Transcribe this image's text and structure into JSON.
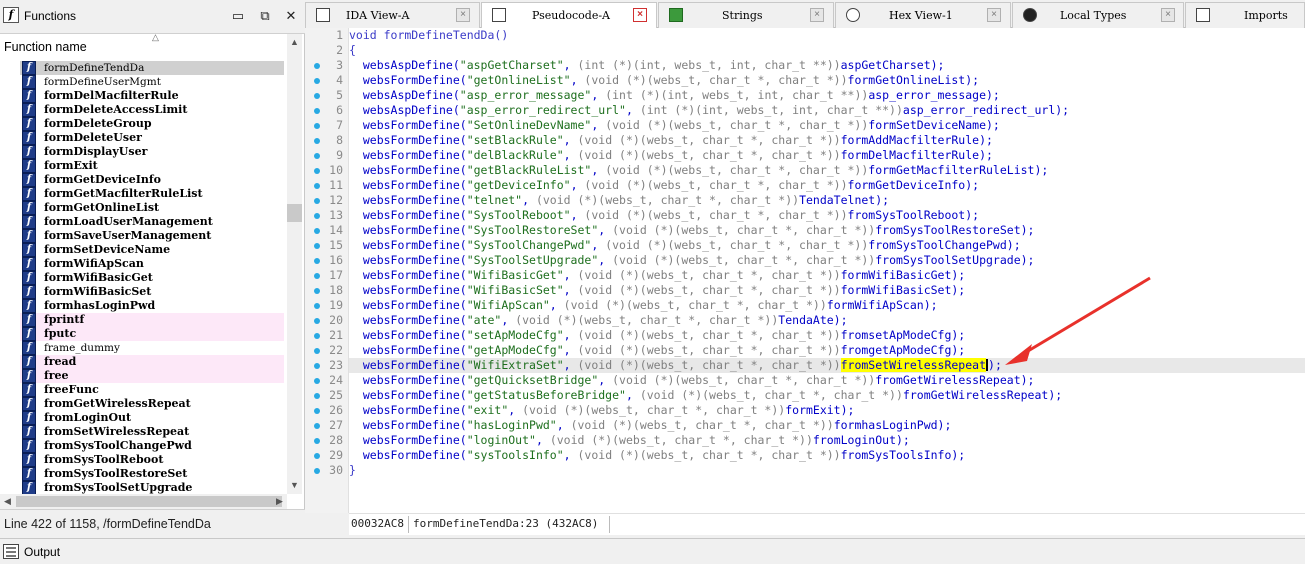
{
  "functions_panel": {
    "title": "Functions",
    "column_header": "Function name",
    "status": "Line 422 of 1158, /formDefineTendDa",
    "items": [
      {
        "name": "formDefineTendDa",
        "style": "normal",
        "highlight": "selected"
      },
      {
        "name": "formDefineUserMgmt",
        "style": "normal",
        "highlight": "none"
      },
      {
        "name": "formDelMacfilterRule",
        "style": "bold",
        "highlight": "none"
      },
      {
        "name": "formDeleteAccessLimit",
        "style": "bold",
        "highlight": "none"
      },
      {
        "name": "formDeleteGroup",
        "style": "bold",
        "highlight": "none"
      },
      {
        "name": "formDeleteUser",
        "style": "bold",
        "highlight": "none"
      },
      {
        "name": "formDisplayUser",
        "style": "bold",
        "highlight": "none"
      },
      {
        "name": "formExit",
        "style": "bold",
        "highlight": "none"
      },
      {
        "name": "formGetDeviceInfo",
        "style": "bold",
        "highlight": "none"
      },
      {
        "name": "formGetMacfilterRuleList",
        "style": "bold",
        "highlight": "none"
      },
      {
        "name": "formGetOnlineList",
        "style": "bold",
        "highlight": "none"
      },
      {
        "name": "formLoadUserManagement",
        "style": "bold",
        "highlight": "none"
      },
      {
        "name": "formSaveUserManagement",
        "style": "bold",
        "highlight": "none"
      },
      {
        "name": "formSetDeviceName",
        "style": "bold",
        "highlight": "none"
      },
      {
        "name": "formWifiApScan",
        "style": "bold",
        "highlight": "none"
      },
      {
        "name": "formWifiBasicGet",
        "style": "bold",
        "highlight": "none"
      },
      {
        "name": "formWifiBasicSet",
        "style": "bold",
        "highlight": "none"
      },
      {
        "name": "formhasLoginPwd",
        "style": "bold",
        "highlight": "none"
      },
      {
        "name": "fprintf",
        "style": "bold",
        "highlight": "pink"
      },
      {
        "name": "fputc",
        "style": "bold",
        "highlight": "pink"
      },
      {
        "name": "frame_dummy",
        "style": "normal",
        "highlight": "none"
      },
      {
        "name": "fread",
        "style": "bold",
        "highlight": "pink"
      },
      {
        "name": "free",
        "style": "bold",
        "highlight": "pink"
      },
      {
        "name": "freeFunc",
        "style": "bold",
        "highlight": "none"
      },
      {
        "name": "fromGetWirelessRepeat",
        "style": "bold",
        "highlight": "none"
      },
      {
        "name": "fromLoginOut",
        "style": "bold",
        "highlight": "none"
      },
      {
        "name": "fromSetWirelessRepeat",
        "style": "bold",
        "highlight": "none"
      },
      {
        "name": "fromSysToolChangePwd",
        "style": "bold",
        "highlight": "none"
      },
      {
        "name": "fromSysToolReboot",
        "style": "bold",
        "highlight": "none"
      },
      {
        "name": "fromSysToolRestoreSet",
        "style": "bold",
        "highlight": "none"
      },
      {
        "name": "fromSysToolSetUpgrade",
        "style": "bold",
        "highlight": "none"
      }
    ]
  },
  "tabs": [
    {
      "label": "IDA View-A",
      "icon": "ida-view-icon",
      "active": false
    },
    {
      "label": "Pseudocode-A",
      "icon": "pseudocode-icon",
      "active": true
    },
    {
      "label": "Strings",
      "icon": "strings-icon",
      "active": false
    },
    {
      "label": "Hex View-1",
      "icon": "hex-view-icon",
      "active": false
    },
    {
      "label": "Local Types",
      "icon": "local-types-icon",
      "active": false
    },
    {
      "label": "Imports",
      "icon": "imports-icon",
      "active": false
    }
  ],
  "code": {
    "current_line": 23,
    "lines": [
      {
        "num": "1",
        "dot": false,
        "parts": [
          {
            "t": "void formDefineTendDa()",
            "c": "kw"
          }
        ]
      },
      {
        "num": "2",
        "dot": false,
        "parts": [
          {
            "t": "{",
            "c": "kw"
          }
        ]
      },
      {
        "num": "3",
        "dot": true,
        "parts": [
          {
            "t": "  websAspDefine(",
            "c": ""
          },
          {
            "t": "\"aspGetCharset\"",
            "c": "str"
          },
          {
            "t": ", ",
            "c": ""
          },
          {
            "t": "(int (*)(int, webs_t, int, char_t **))",
            "c": "cast"
          },
          {
            "t": "aspGetCharset);",
            "c": ""
          }
        ]
      },
      {
        "num": "4",
        "dot": true,
        "parts": [
          {
            "t": "  websFormDefine(",
            "c": ""
          },
          {
            "t": "\"getOnlineList\"",
            "c": "str"
          },
          {
            "t": ", ",
            "c": ""
          },
          {
            "t": "(void (*)(webs_t, char_t *, char_t *))",
            "c": "cast"
          },
          {
            "t": "formGetOnlineList);",
            "c": ""
          }
        ]
      },
      {
        "num": "5",
        "dot": true,
        "parts": [
          {
            "t": "  websAspDefine(",
            "c": ""
          },
          {
            "t": "\"asp_error_message\"",
            "c": "str"
          },
          {
            "t": ", ",
            "c": ""
          },
          {
            "t": "(int (*)(int, webs_t, int, char_t **))",
            "c": "cast"
          },
          {
            "t": "asp_error_message);",
            "c": ""
          }
        ]
      },
      {
        "num": "6",
        "dot": true,
        "parts": [
          {
            "t": "  websAspDefine(",
            "c": ""
          },
          {
            "t": "\"asp_error_redirect_url\"",
            "c": "str"
          },
          {
            "t": ", ",
            "c": ""
          },
          {
            "t": "(int (*)(int, webs_t, int, char_t **))",
            "c": "cast"
          },
          {
            "t": "asp_error_redirect_url);",
            "c": ""
          }
        ]
      },
      {
        "num": "7",
        "dot": true,
        "parts": [
          {
            "t": "  websFormDefine(",
            "c": ""
          },
          {
            "t": "\"SetOnlineDevName\"",
            "c": "str"
          },
          {
            "t": ", ",
            "c": ""
          },
          {
            "t": "(void (*)(webs_t, char_t *, char_t *))",
            "c": "cast"
          },
          {
            "t": "formSetDeviceName);",
            "c": ""
          }
        ]
      },
      {
        "num": "8",
        "dot": true,
        "parts": [
          {
            "t": "  websFormDefine(",
            "c": ""
          },
          {
            "t": "\"setBlackRule\"",
            "c": "str"
          },
          {
            "t": ", ",
            "c": ""
          },
          {
            "t": "(void (*)(webs_t, char_t *, char_t *))",
            "c": "cast"
          },
          {
            "t": "formAddMacfilterRule);",
            "c": ""
          }
        ]
      },
      {
        "num": "9",
        "dot": true,
        "parts": [
          {
            "t": "  websFormDefine(",
            "c": ""
          },
          {
            "t": "\"delBlackRule\"",
            "c": "str"
          },
          {
            "t": ", ",
            "c": ""
          },
          {
            "t": "(void (*)(webs_t, char_t *, char_t *))",
            "c": "cast"
          },
          {
            "t": "formDelMacfilterRule);",
            "c": ""
          }
        ]
      },
      {
        "num": "10",
        "dot": true,
        "parts": [
          {
            "t": "  websFormDefine(",
            "c": ""
          },
          {
            "t": "\"getBlackRuleList\"",
            "c": "str"
          },
          {
            "t": ", ",
            "c": ""
          },
          {
            "t": "(void (*)(webs_t, char_t *, char_t *))",
            "c": "cast"
          },
          {
            "t": "formGetMacfilterRuleList);",
            "c": ""
          }
        ]
      },
      {
        "num": "11",
        "dot": true,
        "parts": [
          {
            "t": "  websFormDefine(",
            "c": ""
          },
          {
            "t": "\"getDeviceInfo\"",
            "c": "str"
          },
          {
            "t": ", ",
            "c": ""
          },
          {
            "t": "(void (*)(webs_t, char_t *, char_t *))",
            "c": "cast"
          },
          {
            "t": "formGetDeviceInfo);",
            "c": ""
          }
        ]
      },
      {
        "num": "12",
        "dot": true,
        "parts": [
          {
            "t": "  websFormDefine(",
            "c": ""
          },
          {
            "t": "\"telnet\"",
            "c": "str"
          },
          {
            "t": ", ",
            "c": ""
          },
          {
            "t": "(void (*)(webs_t, char_t *, char_t *))",
            "c": "cast"
          },
          {
            "t": "TendaTelnet);",
            "c": ""
          }
        ]
      },
      {
        "num": "13",
        "dot": true,
        "parts": [
          {
            "t": "  websFormDefine(",
            "c": ""
          },
          {
            "t": "\"SysToolReboot\"",
            "c": "str"
          },
          {
            "t": ", ",
            "c": ""
          },
          {
            "t": "(void (*)(webs_t, char_t *, char_t *))",
            "c": "cast"
          },
          {
            "t": "fromSysToolReboot);",
            "c": ""
          }
        ]
      },
      {
        "num": "14",
        "dot": true,
        "parts": [
          {
            "t": "  websFormDefine(",
            "c": ""
          },
          {
            "t": "\"SysToolRestoreSet\"",
            "c": "str"
          },
          {
            "t": ", ",
            "c": ""
          },
          {
            "t": "(void (*)(webs_t, char_t *, char_t *))",
            "c": "cast"
          },
          {
            "t": "fromSysToolRestoreSet);",
            "c": ""
          }
        ]
      },
      {
        "num": "15",
        "dot": true,
        "parts": [
          {
            "t": "  websFormDefine(",
            "c": ""
          },
          {
            "t": "\"SysToolChangePwd\"",
            "c": "str"
          },
          {
            "t": ", ",
            "c": ""
          },
          {
            "t": "(void (*)(webs_t, char_t *, char_t *))",
            "c": "cast"
          },
          {
            "t": "fromSysToolChangePwd);",
            "c": ""
          }
        ]
      },
      {
        "num": "16",
        "dot": true,
        "parts": [
          {
            "t": "  websFormDefine(",
            "c": ""
          },
          {
            "t": "\"SysToolSetUpgrade\"",
            "c": "str"
          },
          {
            "t": ", ",
            "c": ""
          },
          {
            "t": "(void (*)(webs_t, char_t *, char_t *))",
            "c": "cast"
          },
          {
            "t": "fromSysToolSetUpgrade);",
            "c": ""
          }
        ]
      },
      {
        "num": "17",
        "dot": true,
        "parts": [
          {
            "t": "  websFormDefine(",
            "c": ""
          },
          {
            "t": "\"WifiBasicGet\"",
            "c": "str"
          },
          {
            "t": ", ",
            "c": ""
          },
          {
            "t": "(void (*)(webs_t, char_t *, char_t *))",
            "c": "cast"
          },
          {
            "t": "formWifiBasicGet);",
            "c": ""
          }
        ]
      },
      {
        "num": "18",
        "dot": true,
        "parts": [
          {
            "t": "  websFormDefine(",
            "c": ""
          },
          {
            "t": "\"WifiBasicSet\"",
            "c": "str"
          },
          {
            "t": ", ",
            "c": ""
          },
          {
            "t": "(void (*)(webs_t, char_t *, char_t *))",
            "c": "cast"
          },
          {
            "t": "formWifiBasicSet);",
            "c": ""
          }
        ]
      },
      {
        "num": "19",
        "dot": true,
        "parts": [
          {
            "t": "  websFormDefine(",
            "c": ""
          },
          {
            "t": "\"WifiApScan\"",
            "c": "str"
          },
          {
            "t": ", ",
            "c": ""
          },
          {
            "t": "(void (*)(webs_t, char_t *, char_t *))",
            "c": "cast"
          },
          {
            "t": "formWifiApScan);",
            "c": ""
          }
        ]
      },
      {
        "num": "20",
        "dot": true,
        "parts": [
          {
            "t": "  websFormDefine(",
            "c": ""
          },
          {
            "t": "\"ate\"",
            "c": "str"
          },
          {
            "t": ", ",
            "c": ""
          },
          {
            "t": "(void (*)(webs_t, char_t *, char_t *))",
            "c": "cast"
          },
          {
            "t": "TendaAte);",
            "c": ""
          }
        ]
      },
      {
        "num": "21",
        "dot": true,
        "parts": [
          {
            "t": "  websFormDefine(",
            "c": ""
          },
          {
            "t": "\"setApModeCfg\"",
            "c": "str"
          },
          {
            "t": ", ",
            "c": ""
          },
          {
            "t": "(void (*)(webs_t, char_t *, char_t *))",
            "c": "cast"
          },
          {
            "t": "fromsetApModeCfg);",
            "c": ""
          }
        ]
      },
      {
        "num": "22",
        "dot": true,
        "parts": [
          {
            "t": "  websFormDefine(",
            "c": ""
          },
          {
            "t": "\"getApModeCfg\"",
            "c": "str"
          },
          {
            "t": ", ",
            "c": ""
          },
          {
            "t": "(void (*)(webs_t, char_t *, char_t *))",
            "c": "cast"
          },
          {
            "t": "fromgetApModeCfg);",
            "c": ""
          }
        ]
      },
      {
        "num": "23",
        "dot": true,
        "parts": [
          {
            "t": "  websFormDefine(",
            "c": ""
          },
          {
            "t": "\"WifiExtraSet\"",
            "c": "str"
          },
          {
            "t": ", ",
            "c": ""
          },
          {
            "t": "(void (*)(webs_t, char_t *, char_t *))",
            "c": "cast"
          },
          {
            "t": "fromSetWirelessRepeat",
            "c": "hlname"
          },
          {
            "t": ");",
            "c": ""
          }
        ]
      },
      {
        "num": "24",
        "dot": true,
        "parts": [
          {
            "t": "  websFormDefine(",
            "c": ""
          },
          {
            "t": "\"getQuicksetBridge\"",
            "c": "str"
          },
          {
            "t": ", ",
            "c": ""
          },
          {
            "t": "(void (*)(webs_t, char_t *, char_t *))",
            "c": "cast"
          },
          {
            "t": "fromGetWirelessRepeat);",
            "c": ""
          }
        ]
      },
      {
        "num": "25",
        "dot": true,
        "parts": [
          {
            "t": "  websFormDefine(",
            "c": ""
          },
          {
            "t": "\"getStatusBeforeBridge\"",
            "c": "str"
          },
          {
            "t": ", ",
            "c": ""
          },
          {
            "t": "(void (*)(webs_t, char_t *, char_t *))",
            "c": "cast"
          },
          {
            "t": "fromGetWirelessRepeat);",
            "c": ""
          }
        ]
      },
      {
        "num": "26",
        "dot": true,
        "parts": [
          {
            "t": "  websFormDefine(",
            "c": ""
          },
          {
            "t": "\"exit\"",
            "c": "str"
          },
          {
            "t": ", ",
            "c": ""
          },
          {
            "t": "(void (*)(webs_t, char_t *, char_t *))",
            "c": "cast"
          },
          {
            "t": "formExit);",
            "c": ""
          }
        ]
      },
      {
        "num": "27",
        "dot": true,
        "parts": [
          {
            "t": "  websFormDefine(",
            "c": ""
          },
          {
            "t": "\"hasLoginPwd\"",
            "c": "str"
          },
          {
            "t": ", ",
            "c": ""
          },
          {
            "t": "(void (*)(webs_t, char_t *, char_t *))",
            "c": "cast"
          },
          {
            "t": "formhasLoginPwd);",
            "c": ""
          }
        ]
      },
      {
        "num": "28",
        "dot": true,
        "parts": [
          {
            "t": "  websFormDefine(",
            "c": ""
          },
          {
            "t": "\"loginOut\"",
            "c": "str"
          },
          {
            "t": ", ",
            "c": ""
          },
          {
            "t": "(void (*)(webs_t, char_t *, char_t *))",
            "c": "cast"
          },
          {
            "t": "fromLoginOut);",
            "c": ""
          }
        ]
      },
      {
        "num": "29",
        "dot": true,
        "parts": [
          {
            "t": "  websFormDefine(",
            "c": ""
          },
          {
            "t": "\"sysToolsInfo\"",
            "c": "str"
          },
          {
            "t": ", ",
            "c": ""
          },
          {
            "t": "(void (*)(webs_t, char_t *, char_t *))",
            "c": "cast"
          },
          {
            "t": "fromSysToolsInfo);",
            "c": ""
          }
        ]
      },
      {
        "num": "30",
        "dot": true,
        "parts": [
          {
            "t": "}",
            "c": "kw"
          }
        ]
      }
    ]
  },
  "address_bar": {
    "address": "00032AC8",
    "location": "formDefineTendDa:23 (432AC8)"
  },
  "output_panel": {
    "title": "Output"
  },
  "colors": {
    "accent_arrow": "#e8312b",
    "highlight_yellow": "#ffff00",
    "breakpoint_dot": "#27a9e3"
  }
}
